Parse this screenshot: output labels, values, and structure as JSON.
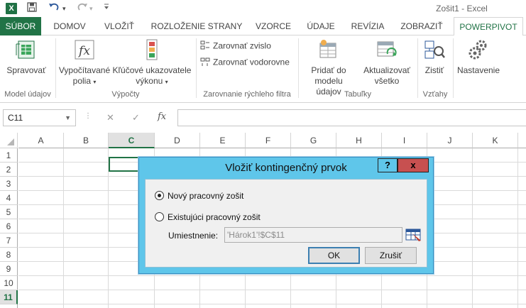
{
  "window": {
    "app_letter": "X",
    "title": "Zošit1 - Excel",
    "qat_dropdown": "▾"
  },
  "tabs": [
    {
      "label": "SÚBOR"
    },
    {
      "label": "DOMOV"
    },
    {
      "label": "VLOŽIŤ"
    },
    {
      "label": "ROZLOŽENIE STRANY"
    },
    {
      "label": "VZORCE"
    },
    {
      "label": "ÚDAJE"
    },
    {
      "label": "REVÍZIA"
    },
    {
      "label": "ZOBRAZIŤ"
    },
    {
      "label": "POWERPIVOT"
    }
  ],
  "ribbon": {
    "manage": "Spravovať",
    "calc_fields_1": "Vypočítavané",
    "calc_fields_2": "polia",
    "kpi_1": "Kľúčové ukazovatele",
    "kpi_2": "výkonu",
    "align_vertical": "Zarovnať zvislo",
    "align_horizontal": "Zarovnať vodorovne",
    "add_model_1": "Pridať do",
    "add_model_2": "modelu údajov",
    "refresh_1": "Aktualizovať",
    "refresh_2": "všetko",
    "detect": "Zistiť",
    "settings": "Nastavenie",
    "groups": {
      "data_model": "Model údajov",
      "calculations": "Výpočty",
      "slicer_alignment": "Zarovnanie rýchleho filtra",
      "tables": "Tabuľky",
      "relationships": "Vzťahy"
    }
  },
  "formula_bar": {
    "name_box": "C11",
    "cancel": "✕",
    "enter": "✓",
    "fx": "fx",
    "value": ""
  },
  "sheet": {
    "columns": [
      "A",
      "B",
      "C",
      "D",
      "E",
      "F",
      "G",
      "H",
      "I",
      "J",
      "K"
    ],
    "rows": [
      "1",
      "2",
      "3",
      "4",
      "5",
      "6",
      "7",
      "8",
      "9",
      "10",
      "11"
    ],
    "selected_column": "C",
    "selected_row": "11"
  },
  "dialog": {
    "title": "Vložiť kontingenčný prvok",
    "help": "?",
    "close": "x",
    "option_new": "Nový pracovný zošit",
    "option_existing": "Existujúci pracovný zošit",
    "location_label": "Umiestnenie:",
    "location_value": "'Hárok1'!$C$11",
    "ok": "OK",
    "cancel": "Zrušiť"
  }
}
